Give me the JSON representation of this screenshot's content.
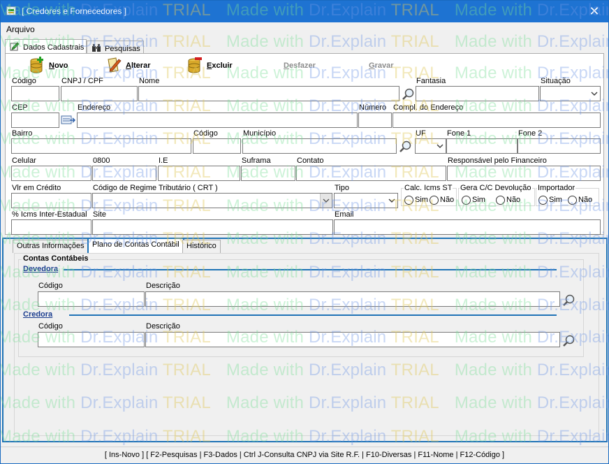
{
  "window": {
    "title": "[ Credores e Fornecedores ]",
    "close_glyph": "✕"
  },
  "menu": {
    "file": "Arquivo"
  },
  "tabs": {
    "dados": "Dados Cadastrais",
    "pesquisas": "Pesquisas"
  },
  "toolbar": {
    "novo": {
      "accel": "N",
      "rest": "ovo"
    },
    "alterar": {
      "accel": "A",
      "rest": "lterar"
    },
    "excluir": {
      "accel": "E",
      "rest": "xcluir"
    },
    "desfazer": {
      "accel": "D",
      "rest": "esfazer"
    },
    "gravar": {
      "accel": "G",
      "rest": "ravar"
    }
  },
  "labels": {
    "codigo": "Código",
    "cnpj": "CNPJ / CPF",
    "nome": "Nome",
    "fantasia": "Fantasia",
    "situacao": "Situação",
    "cep": "CEP",
    "endereco": "Endereço",
    "numero": "Número",
    "compl": "Compl. do Endereço",
    "bairro": "Bairro",
    "codigo2": "Código",
    "municipio": "Município",
    "uf": "UF",
    "fone1": "Fone 1",
    "fone2": "Fone 2",
    "celular": "Celular",
    "l0800": "0800",
    "ie": "I.E",
    "suframa": "Suframa",
    "contato": "Contato",
    "responsavel": "Responsável pelo Financeiro",
    "vlr_credito": "Vlr em Crédito",
    "crt": "Código de Regime Tributário ( CRT )",
    "tipo": "Tipo",
    "calc_icms": "Calc. Icms ST",
    "gera_cc": "Gera C/C Devolução",
    "importador": "Importador",
    "sim": "Sim",
    "nao": "Não",
    "icms_inter": "% Icms Inter-Estadual",
    "site": "Site",
    "email": "Email"
  },
  "subtabs": {
    "outras": "Outras Informações",
    "plano": "Plano de Contas Contábil",
    "historico": "Histórico"
  },
  "contas": {
    "title": "Contas Contábeis",
    "devedora": "Devedora",
    "credora": "Credora",
    "codigo": "Código",
    "descricao": "Descrição"
  },
  "statusbar": {
    "text": "[ Ins-Novo ] [ F2-Pesquisas | F3-Dados | Ctrl J-Consulta CNPJ via Site R.F. | F10-Diversas | F11-Nome | F12-Código ]"
  },
  "watermark": {
    "made_with": "Made with ",
    "brand": "Dr.Explain",
    "trial": "TRIAL"
  },
  "colors": {
    "titlebar": "#1e73d2",
    "accent_blue": "#1f73b6",
    "section_text": "#1a3c8e"
  }
}
